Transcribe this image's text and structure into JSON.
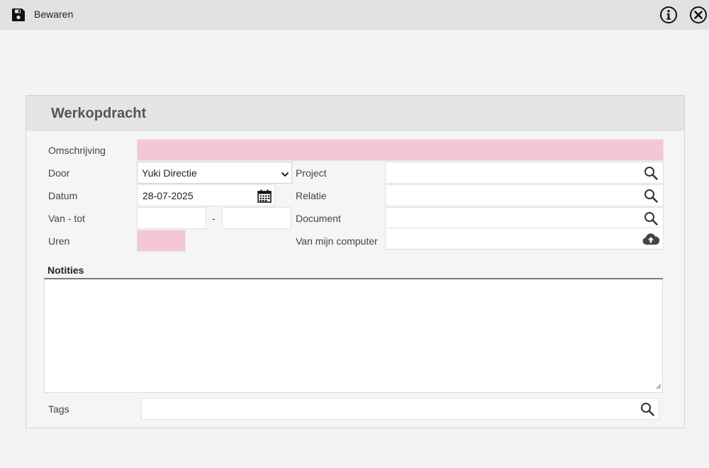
{
  "toolbar": {
    "save_label": "Bewaren",
    "icons": [
      "save-icon",
      "info-icon",
      "close-icon"
    ]
  },
  "form": {
    "title": "Werkopdracht",
    "labels": {
      "omschrijving": "Omschrijving",
      "door": "Door",
      "datum": "Datum",
      "van_tot": "Van - tot",
      "uren": "Uren",
      "project": "Project",
      "relatie": "Relatie",
      "document": "Document",
      "van_mijn_computer": "Van mijn computer",
      "notities": "Notities",
      "tags": "Tags"
    },
    "values": {
      "omschrijving": "",
      "door": "Yuki Directie",
      "datum": "28-07-2025",
      "van": "",
      "tot": "",
      "uren": "",
      "project": "",
      "relatie": "",
      "document": "",
      "notities": "",
      "tags": ""
    },
    "van_tot_separator": "-",
    "colors": {
      "required_field": "#f5c6d3",
      "header_bg": "#e4e4e4",
      "topbar_bg": "#e1e1e1"
    }
  }
}
